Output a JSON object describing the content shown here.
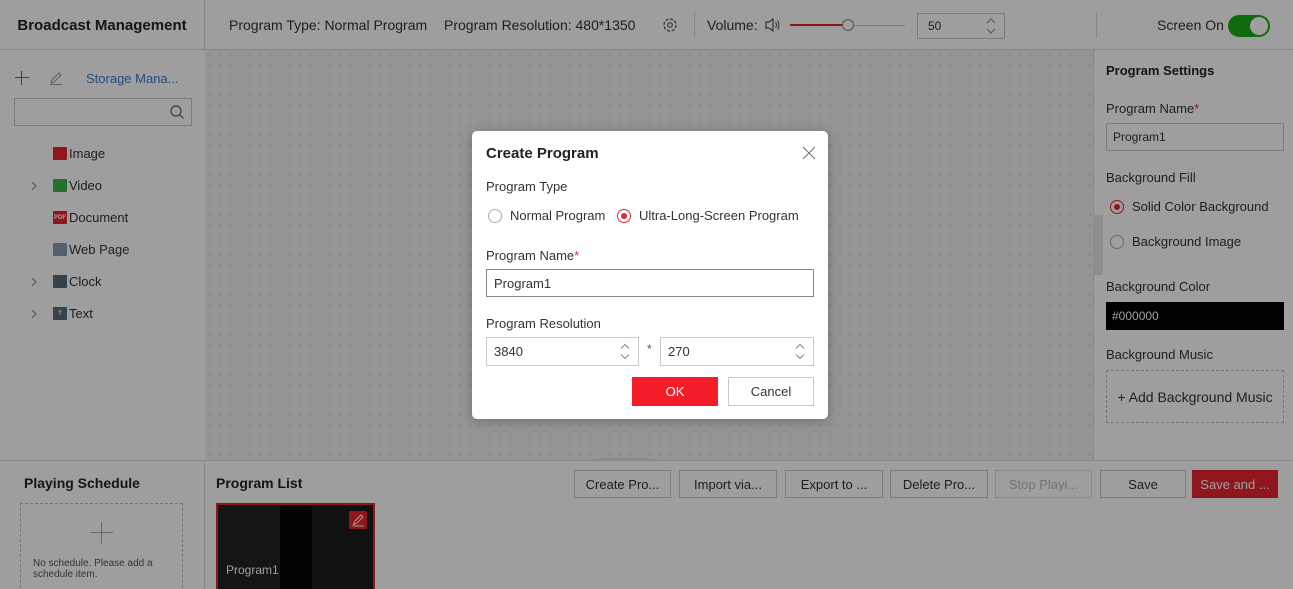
{
  "header": {
    "title": "Broadcast Management",
    "program_type": "Program Type: Normal Program",
    "program_resolution": "Program Resolution: 480*1350",
    "volume_label": "Volume:",
    "volume_value": "50",
    "screen_label": "Screen On"
  },
  "left_panel": {
    "storage_link": "Storage Mana...",
    "tree": [
      {
        "label": "Image",
        "icon": "image-icon",
        "color": "#e8252f",
        "expandable": false,
        "badge": ""
      },
      {
        "label": "Video",
        "icon": "video-icon",
        "color": "#3bb54a",
        "expandable": true,
        "badge": ""
      },
      {
        "label": "Document",
        "icon": "pdf-icon",
        "color": "#e8252f",
        "expandable": false,
        "badge": "PDF"
      },
      {
        "label": "Web Page",
        "icon": "web-page-icon",
        "color": "#8a9bb0",
        "expandable": false,
        "badge": ""
      },
      {
        "label": "Clock",
        "icon": "clock-icon",
        "color": "#5a6a7a",
        "expandable": true,
        "badge": ""
      },
      {
        "label": "Text",
        "icon": "text-icon",
        "color": "#5a6a7a",
        "expandable": true,
        "badge": "T"
      }
    ]
  },
  "right_panel": {
    "title": "Program Settings",
    "program_name_label": "Program Name",
    "program_name_value": "Program1",
    "background_fill_label": "Background Fill",
    "fill_solid": "Solid Color Background",
    "fill_image": "Background Image",
    "background_color_label": "Background Color",
    "background_color_value": "#000000",
    "background_music_label": "Background Music",
    "add_music": "+ Add Background Music"
  },
  "schedule": {
    "title": "Playing Schedule",
    "empty_text": "No schedule. Please add a schedule item."
  },
  "program_list": {
    "title": "Program List",
    "buttons": {
      "create": "Create Pro...",
      "import": "Import via...",
      "export": "Export to ...",
      "delete": "Delete Pro...",
      "stop": "Stop Playi...",
      "save": "Save",
      "save_and": "Save and ..."
    },
    "programs": [
      {
        "name": "Program1"
      }
    ]
  },
  "modal": {
    "title": "Create Program",
    "program_type_label": "Program Type",
    "option_normal": "Normal Program",
    "option_ultra": "Ultra-Long-Screen Program",
    "program_name_label": "Program Name",
    "program_name_value": "Program1",
    "resolution_label": "Program Resolution",
    "width_value": "3840",
    "separator": "*",
    "height_value": "270",
    "ok": "OK",
    "cancel": "Cancel"
  },
  "colors": {
    "accent": "#e8252f",
    "toggle_on": "#1aad19"
  }
}
